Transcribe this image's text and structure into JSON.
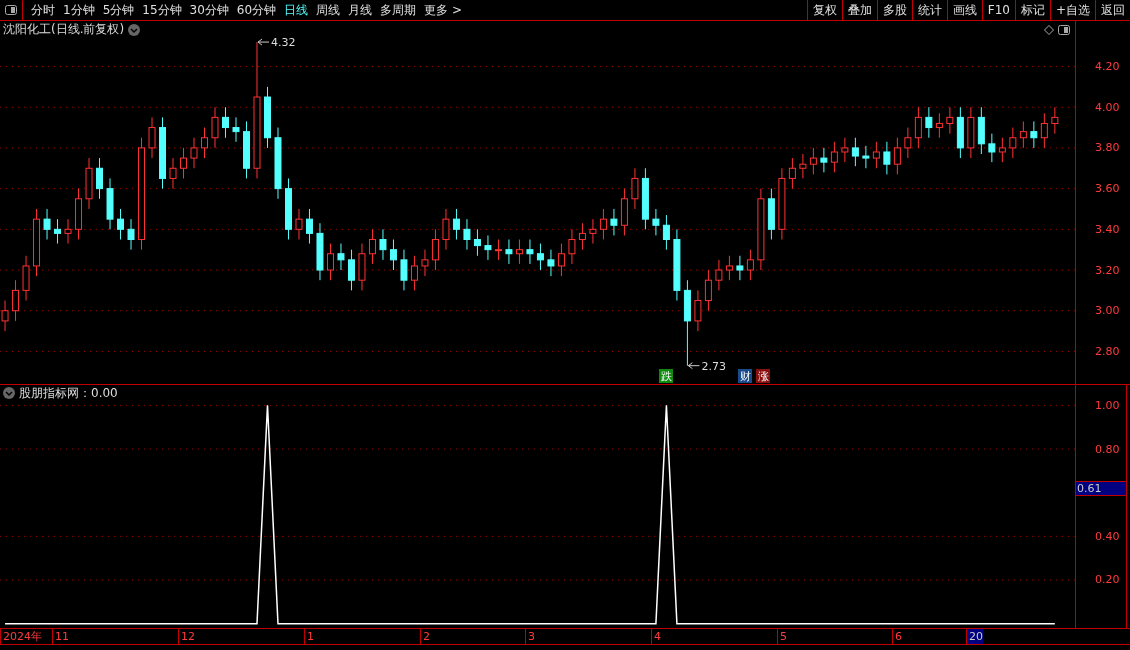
{
  "toolbar": {
    "periods": [
      {
        "label": "分时",
        "selected": false
      },
      {
        "label": "1分钟",
        "selected": false
      },
      {
        "label": "5分钟",
        "selected": false
      },
      {
        "label": "15分钟",
        "selected": false
      },
      {
        "label": "30分钟",
        "selected": false
      },
      {
        "label": "60分钟",
        "selected": false
      },
      {
        "label": "日线",
        "selected": true
      },
      {
        "label": "周线",
        "selected": false
      },
      {
        "label": "月线",
        "selected": false
      },
      {
        "label": "多周期",
        "selected": false
      },
      {
        "label": "更多 >",
        "selected": false
      }
    ],
    "actions": [
      "复权",
      "叠加",
      "多股",
      "统计",
      "画线",
      "F10",
      "标记",
      "+自选",
      "返回"
    ]
  },
  "price_chart": {
    "title": "沈阳化工(日线.前复权)",
    "chart_data": {
      "type": "candlestick",
      "ylim": [
        2.64,
        4.34
      ],
      "grid": true,
      "yticks": [
        {
          "value": 4.2,
          "label": "4.20"
        },
        {
          "value": 4.0,
          "label": "4.00"
        },
        {
          "value": 3.8,
          "label": "3.80"
        },
        {
          "value": 3.6,
          "label": "3.60"
        },
        {
          "value": 3.4,
          "label": "3.40"
        },
        {
          "value": 3.2,
          "label": "3.20"
        },
        {
          "value": 3.0,
          "label": "3.00"
        },
        {
          "value": 2.8,
          "label": "2.80"
        }
      ],
      "categories": [
        null,
        null,
        null,
        null,
        null,
        null,
        null,
        null,
        null,
        null,
        null,
        null,
        null,
        null,
        null,
        null,
        null,
        null,
        null,
        null,
        null,
        null,
        null,
        null,
        null,
        null,
        null,
        null,
        null,
        null,
        null,
        null,
        null,
        null,
        null,
        null,
        null,
        null,
        null,
        null,
        null,
        null,
        null,
        null,
        null,
        null,
        null,
        null,
        null,
        null,
        null,
        null,
        null,
        null,
        null,
        null,
        null,
        null,
        null,
        null,
        null,
        null,
        null,
        null,
        null,
        null,
        null,
        null,
        null,
        null,
        null,
        null,
        null,
        null,
        null,
        null,
        null,
        null,
        null,
        null,
        null,
        null,
        null,
        null,
        null,
        null,
        null,
        null,
        null,
        null,
        null,
        null,
        null,
        null,
        null,
        null,
        null,
        null,
        null,
        null,
        null
      ],
      "ohlc": [
        [
          2.95,
          3.05,
          2.9,
          3.0
        ],
        [
          3.0,
          3.15,
          2.95,
          3.1
        ],
        [
          3.1,
          3.27,
          3.05,
          3.22
        ],
        [
          3.22,
          3.5,
          3.17,
          3.45
        ],
        [
          3.45,
          3.5,
          3.35,
          3.4
        ],
        [
          3.4,
          3.45,
          3.33,
          3.38
        ],
        [
          3.38,
          3.45,
          3.33,
          3.4
        ],
        [
          3.4,
          3.6,
          3.35,
          3.55
        ],
        [
          3.55,
          3.75,
          3.5,
          3.7
        ],
        [
          3.7,
          3.75,
          3.55,
          3.6
        ],
        [
          3.6,
          3.65,
          3.4,
          3.45
        ],
        [
          3.45,
          3.5,
          3.35,
          3.4
        ],
        [
          3.4,
          3.45,
          3.3,
          3.35
        ],
        [
          3.35,
          3.85,
          3.3,
          3.8
        ],
        [
          3.8,
          3.95,
          3.75,
          3.9
        ],
        [
          3.9,
          3.95,
          3.6,
          3.65
        ],
        [
          3.65,
          3.75,
          3.6,
          3.7
        ],
        [
          3.7,
          3.8,
          3.65,
          3.75
        ],
        [
          3.75,
          3.85,
          3.7,
          3.8
        ],
        [
          3.8,
          3.9,
          3.75,
          3.85
        ],
        [
          3.85,
          4.0,
          3.8,
          3.95
        ],
        [
          3.95,
          4.0,
          3.85,
          3.9
        ],
        [
          3.9,
          3.95,
          3.83,
          3.88
        ],
        [
          3.88,
          3.93,
          3.65,
          3.7
        ],
        [
          3.7,
          4.32,
          3.65,
          4.05
        ],
        [
          4.05,
          4.1,
          3.8,
          3.85
        ],
        [
          3.85,
          3.9,
          3.55,
          3.6
        ],
        [
          3.6,
          3.65,
          3.35,
          3.4
        ],
        [
          3.4,
          3.5,
          3.35,
          3.45
        ],
        [
          3.45,
          3.5,
          3.33,
          3.38
        ],
        [
          3.38,
          3.43,
          3.15,
          3.2
        ],
        [
          3.2,
          3.33,
          3.15,
          3.28
        ],
        [
          3.28,
          3.33,
          3.2,
          3.25
        ],
        [
          3.25,
          3.3,
          3.1,
          3.15
        ],
        [
          3.15,
          3.33,
          3.1,
          3.28
        ],
        [
          3.28,
          3.4,
          3.23,
          3.35
        ],
        [
          3.35,
          3.4,
          3.25,
          3.3
        ],
        [
          3.3,
          3.35,
          3.2,
          3.25
        ],
        [
          3.25,
          3.3,
          3.1,
          3.15
        ],
        [
          3.15,
          3.27,
          3.1,
          3.22
        ],
        [
          3.22,
          3.3,
          3.17,
          3.25
        ],
        [
          3.25,
          3.4,
          3.2,
          3.35
        ],
        [
          3.35,
          3.5,
          3.3,
          3.45
        ],
        [
          3.45,
          3.5,
          3.35,
          3.4
        ],
        [
          3.4,
          3.45,
          3.3,
          3.35
        ],
        [
          3.35,
          3.4,
          3.27,
          3.32
        ],
        [
          3.32,
          3.37,
          3.25,
          3.3
        ],
        [
          3.3,
          3.35,
          3.25,
          3.3
        ],
        [
          3.3,
          3.35,
          3.23,
          3.28
        ],
        [
          3.28,
          3.35,
          3.23,
          3.3
        ],
        [
          3.3,
          3.35,
          3.23,
          3.28
        ],
        [
          3.28,
          3.33,
          3.2,
          3.25
        ],
        [
          3.25,
          3.3,
          3.17,
          3.22
        ],
        [
          3.22,
          3.33,
          3.17,
          3.28
        ],
        [
          3.28,
          3.4,
          3.23,
          3.35
        ],
        [
          3.35,
          3.43,
          3.3,
          3.38
        ],
        [
          3.38,
          3.45,
          3.33,
          3.4
        ],
        [
          3.4,
          3.5,
          3.35,
          3.45
        ],
        [
          3.45,
          3.5,
          3.37,
          3.42
        ],
        [
          3.42,
          3.6,
          3.37,
          3.55
        ],
        [
          3.55,
          3.7,
          3.5,
          3.65
        ],
        [
          3.65,
          3.7,
          3.4,
          3.45
        ],
        [
          3.45,
          3.5,
          3.37,
          3.42
        ],
        [
          3.42,
          3.47,
          3.3,
          3.35
        ],
        [
          3.35,
          3.4,
          3.05,
          3.1
        ],
        [
          3.1,
          3.15,
          2.73,
          2.95
        ],
        [
          2.95,
          3.1,
          2.9,
          3.05
        ],
        [
          3.05,
          3.2,
          3.0,
          3.15
        ],
        [
          3.15,
          3.25,
          3.1,
          3.2
        ],
        [
          3.2,
          3.27,
          3.15,
          3.22
        ],
        [
          3.22,
          3.27,
          3.15,
          3.2
        ],
        [
          3.2,
          3.3,
          3.15,
          3.25
        ],
        [
          3.25,
          3.6,
          3.2,
          3.55
        ],
        [
          3.55,
          3.6,
          3.35,
          3.4
        ],
        [
          3.4,
          3.7,
          3.35,
          3.65
        ],
        [
          3.65,
          3.75,
          3.6,
          3.7
        ],
        [
          3.7,
          3.77,
          3.65,
          3.72
        ],
        [
          3.72,
          3.8,
          3.67,
          3.75
        ],
        [
          3.75,
          3.8,
          3.68,
          3.73
        ],
        [
          3.73,
          3.83,
          3.68,
          3.78
        ],
        [
          3.78,
          3.85,
          3.73,
          3.8
        ],
        [
          3.8,
          3.85,
          3.71,
          3.76
        ],
        [
          3.76,
          3.81,
          3.7,
          3.75
        ],
        [
          3.75,
          3.83,
          3.7,
          3.78
        ],
        [
          3.78,
          3.83,
          3.67,
          3.72
        ],
        [
          3.72,
          3.85,
          3.67,
          3.8
        ],
        [
          3.8,
          3.9,
          3.75,
          3.85
        ],
        [
          3.85,
          4.0,
          3.8,
          3.95
        ],
        [
          3.95,
          4.0,
          3.85,
          3.9
        ],
        [
          3.9,
          3.97,
          3.85,
          3.92
        ],
        [
          3.92,
          4.0,
          3.87,
          3.95
        ],
        [
          3.95,
          4.0,
          3.75,
          3.8
        ],
        [
          3.8,
          4.0,
          3.75,
          3.95
        ],
        [
          3.95,
          4.0,
          3.77,
          3.82
        ],
        [
          3.82,
          3.87,
          3.73,
          3.78
        ],
        [
          3.78,
          3.85,
          3.73,
          3.8
        ],
        [
          3.8,
          3.9,
          3.75,
          3.85
        ],
        [
          3.85,
          3.93,
          3.8,
          3.88
        ],
        [
          3.88,
          3.93,
          3.8,
          3.85
        ],
        [
          3.85,
          3.97,
          3.8,
          3.92
        ],
        [
          3.92,
          4.0,
          3.87,
          3.95
        ]
      ],
      "annotations": [
        "4.32",
        "2.73"
      ]
    },
    "events": [
      {
        "text": "跌",
        "color": "#0f8a0f"
      },
      {
        "text": "财",
        "color": "#1a4a8a"
      },
      {
        "text": "涨",
        "color": "#8a0f0f"
      }
    ]
  },
  "indicator_chart": {
    "title": "股朋指标网：0.00",
    "cursor_value": "0.61",
    "chart_data": {
      "type": "line",
      "ylim": [
        -0.02,
        1.02
      ],
      "grid": true,
      "yticks": [
        {
          "value": 1.0,
          "label": "1.00"
        },
        {
          "value": 0.8,
          "label": "0.80"
        },
        {
          "value": 0.4,
          "label": "0.40"
        },
        {
          "value": 0.2,
          "label": "0.20"
        }
      ],
      "categories": [
        null,
        null,
        null,
        null,
        null,
        null,
        null,
        null,
        null,
        null,
        null,
        null,
        null,
        null,
        null,
        null,
        null,
        null,
        null,
        null,
        null,
        null,
        null,
        null,
        null,
        null,
        null,
        null,
        null,
        null,
        null,
        null,
        null,
        null,
        null,
        null,
        null,
        null,
        null,
        null,
        null,
        null,
        null,
        null,
        null,
        null,
        null,
        null,
        null,
        null,
        null,
        null,
        null,
        null,
        null,
        null,
        null,
        null,
        null,
        null,
        null,
        null,
        null,
        null,
        null,
        null,
        null,
        null,
        null,
        null,
        null,
        null,
        null,
        null,
        null,
        null,
        null,
        null,
        null,
        null,
        null,
        null,
        null,
        null,
        null,
        null,
        null,
        null,
        null,
        null,
        null,
        null,
        null,
        null,
        null,
        null,
        null,
        null,
        null,
        null,
        null
      ],
      "series": [
        {
          "color": "#ffffff",
          "values": [
            0,
            0,
            0,
            0,
            0,
            0,
            0,
            0,
            0,
            0,
            0,
            0,
            0,
            0,
            0,
            0,
            0,
            0,
            0,
            0,
            0,
            0,
            0,
            0,
            0,
            1,
            0,
            0,
            0,
            0,
            0,
            0,
            0,
            0,
            0,
            0,
            0,
            0,
            0,
            0,
            0,
            0,
            0,
            0,
            0,
            0,
            0,
            0,
            0,
            0,
            0,
            0,
            0,
            0,
            0,
            0,
            0,
            0,
            0,
            0,
            0,
            0,
            0,
            1,
            0,
            0,
            0,
            0,
            0,
            0,
            0,
            0,
            0,
            0,
            0,
            0,
            0,
            0,
            0,
            0,
            0,
            0,
            0,
            0,
            0,
            0,
            0,
            0,
            0,
            0,
            0,
            0,
            0,
            0,
            0,
            0,
            0,
            0,
            0,
            0,
            0
          ]
        }
      ]
    }
  },
  "date_axis": [
    {
      "label": "2024年",
      "selected": false
    },
    {
      "label": "11",
      "selected": false
    },
    {
      "label": "12",
      "selected": false
    },
    {
      "label": "1",
      "selected": false
    },
    {
      "label": "2",
      "selected": false
    },
    {
      "label": "3",
      "selected": false
    },
    {
      "label": "4",
      "selected": false
    },
    {
      "label": "5",
      "selected": false
    },
    {
      "label": "6",
      "selected": false
    },
    {
      "label": "20",
      "selected": true
    }
  ]
}
